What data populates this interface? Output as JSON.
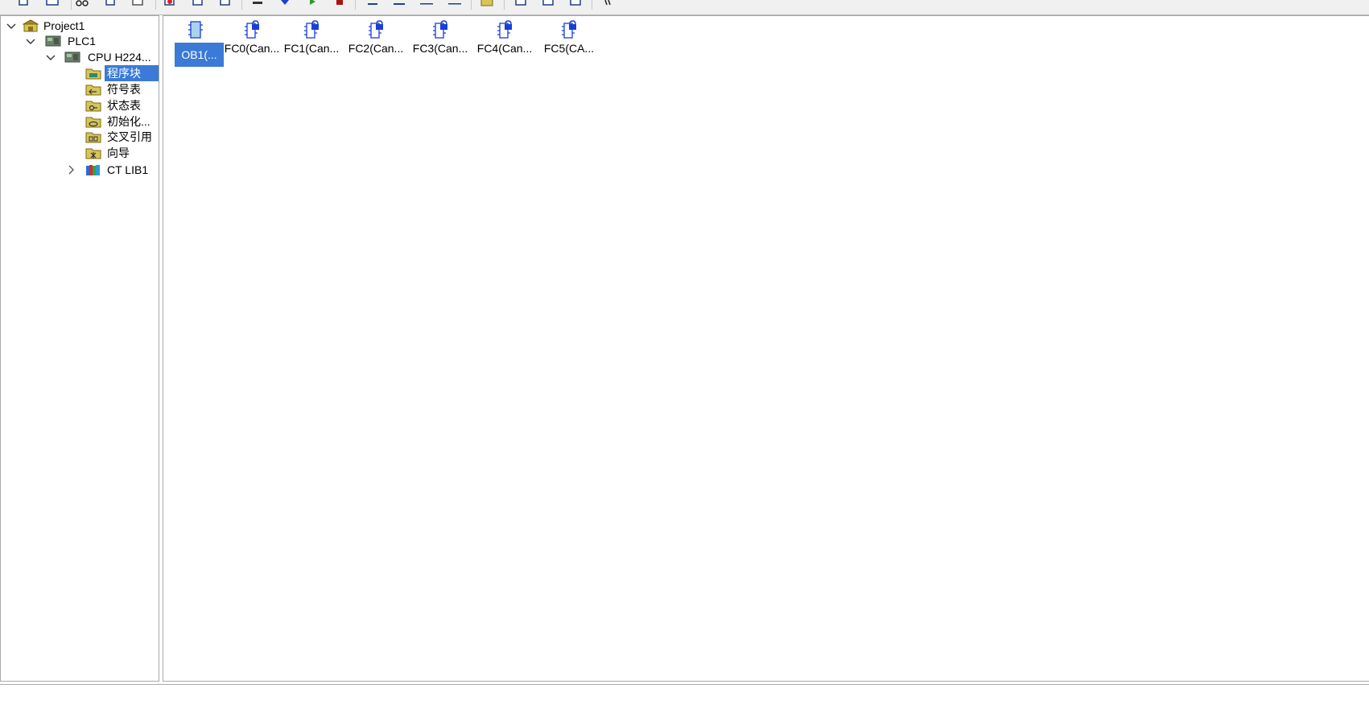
{
  "toolbar": {
    "buttons": [
      {
        "name": "new-icon"
      },
      {
        "name": "open-icon"
      },
      {
        "name": "cut-icon"
      },
      {
        "name": "copy-icon"
      },
      {
        "name": "paste-icon"
      },
      {
        "name": "upload-icon"
      },
      {
        "name": "download-icon"
      },
      {
        "name": "compare-icon"
      },
      {
        "name": "step-icon"
      },
      {
        "name": "download-arrow-icon"
      },
      {
        "name": "run-icon"
      },
      {
        "name": "stop-icon"
      },
      {
        "name": "network-insert-icon"
      },
      {
        "name": "network-delete-icon"
      },
      {
        "name": "contact-icon"
      },
      {
        "name": "coil-icon"
      },
      {
        "name": "library-icon"
      },
      {
        "name": "window-cascade-icon"
      },
      {
        "name": "window-horizontal-icon"
      },
      {
        "name": "window-vertical-icon"
      },
      {
        "name": "help-icon"
      }
    ]
  },
  "tree": {
    "items": [
      {
        "label": "Project1",
        "expanded": true,
        "icon": "project-icon"
      },
      {
        "label": "PLC1",
        "expanded": true,
        "icon": "plc-icon"
      },
      {
        "label": "CPU H224...",
        "expanded": true,
        "icon": "cpu-icon"
      },
      {
        "label": "程序块",
        "selected": true,
        "icon": "program-block-folder-icon"
      },
      {
        "label": "符号表",
        "icon": "symbol-table-folder-icon"
      },
      {
        "label": "状态表",
        "icon": "status-table-folder-icon"
      },
      {
        "label": "初始化...",
        "icon": "init-folder-icon"
      },
      {
        "label": "交叉引用",
        "icon": "cross-reference-folder-icon"
      },
      {
        "label": "向导",
        "icon": "wizard-folder-icon"
      },
      {
        "label": "CT LIB1",
        "expanded": false,
        "icon": "library-books-icon"
      }
    ]
  },
  "blocks": {
    "items": [
      {
        "label": "OB1(...",
        "selected": true,
        "locked": false
      },
      {
        "label": "FC0(Can...",
        "locked": true
      },
      {
        "label": "FC1(Can...",
        "locked": true
      },
      {
        "label": "FC2(Can...",
        "locked": true
      },
      {
        "label": "FC3(Can...",
        "locked": true
      },
      {
        "label": "FC4(Can...",
        "locked": true
      },
      {
        "label": "FC5(CA...",
        "locked": true
      }
    ]
  },
  "colors": {
    "selection": "#3b7ad6",
    "folder": "#d8c55a",
    "lock": "#1a3fd6"
  }
}
